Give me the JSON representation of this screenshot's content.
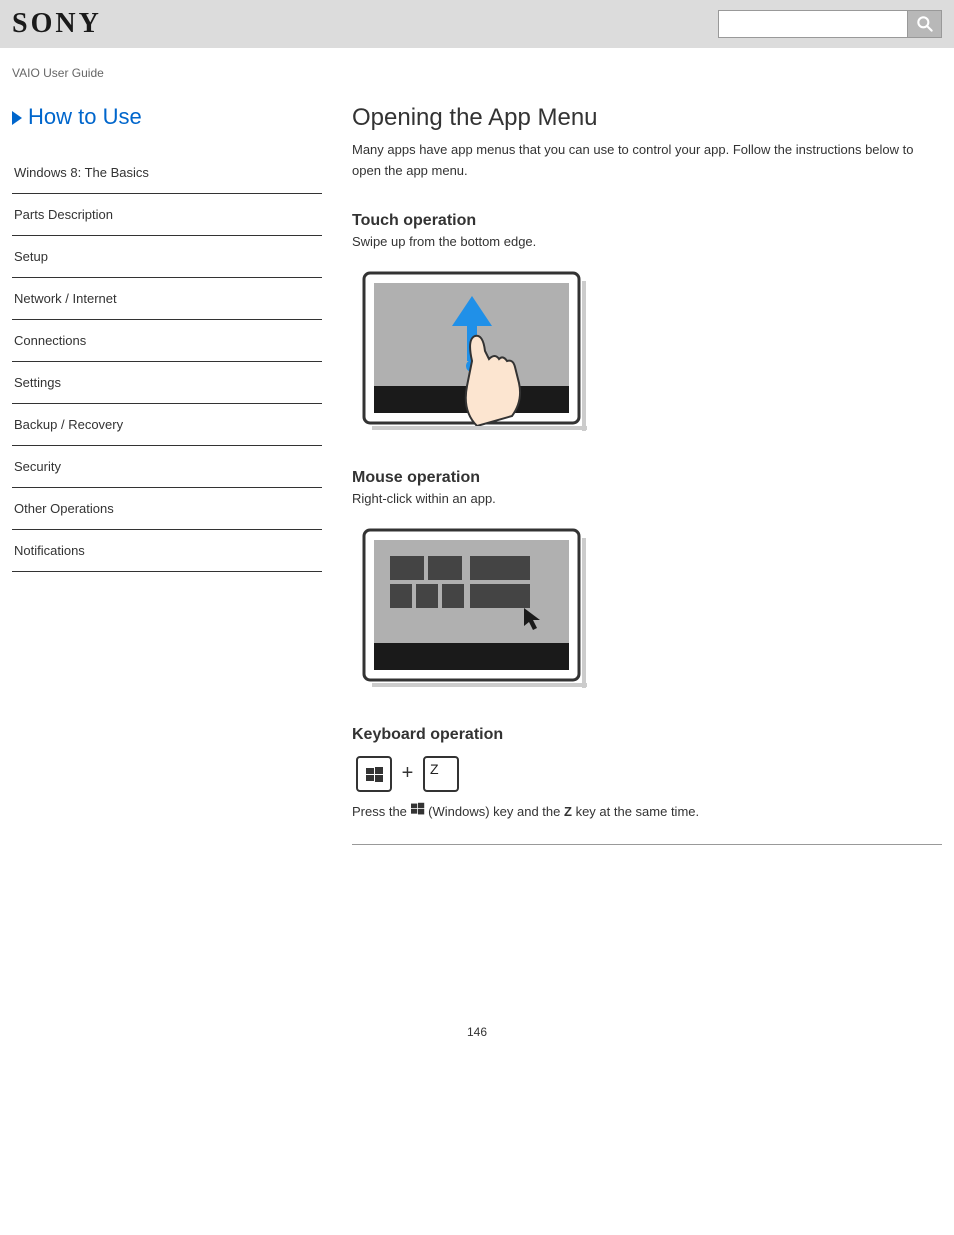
{
  "header": {
    "logo": "SONY",
    "search_placeholder": ""
  },
  "breadcrumb": "VAIO User Guide",
  "sidebar": {
    "title_prefix": "",
    "title": "How to Use",
    "nav_items": [
      "Windows 8: The Basics",
      "Parts Description",
      "Setup",
      "Network / Internet",
      "Connections",
      "Settings",
      "Backup / Recovery",
      "Security",
      "Other Operations",
      "Notifications"
    ]
  },
  "content": {
    "title": "Opening the App Menu",
    "subtitle_line1": "Many apps have app menus that you can use to control your app. Follow the instructions below to",
    "subtitle_line2": "open the app menu.",
    "touch_heading": "Touch operation",
    "touch_sub": "Swipe up from the bottom edge.",
    "mouse_heading": "Mouse operation",
    "mouse_sub": "Right-click within an app.",
    "keyboard_heading": "Keyboard operation",
    "keyboard_line1_prefix": "Press the ",
    "keyboard_line1_mid": " (Windows) key and the ",
    "keyboard_line1_suffix": " key at the same time.",
    "z_key_label": "Z"
  },
  "page_number": "146"
}
